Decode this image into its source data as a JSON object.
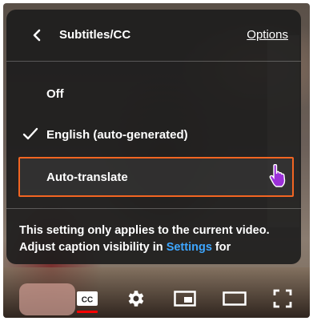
{
  "menu": {
    "title": "Subtitles/CC",
    "options_label": "Options",
    "items": [
      {
        "label": "Off",
        "selected": false
      },
      {
        "label": "English (auto-generated)",
        "selected": true
      },
      {
        "label": "Auto-translate",
        "highlighted": true
      }
    ],
    "info_text_before": "This setting only applies to the current video. Adjust caption visibility in ",
    "info_link": "Settings",
    "info_text_after": " for"
  },
  "controls": {
    "cc_label": "CC",
    "icons": [
      "subtitles-cc-icon",
      "settings-gear-icon",
      "miniplayer-icon",
      "theater-mode-icon",
      "fullscreen-icon"
    ]
  },
  "colors": {
    "highlight_border": "#f26522",
    "link": "#3ea6ff",
    "cc_active": "#ff0000",
    "cursor": "#9b30d9"
  }
}
